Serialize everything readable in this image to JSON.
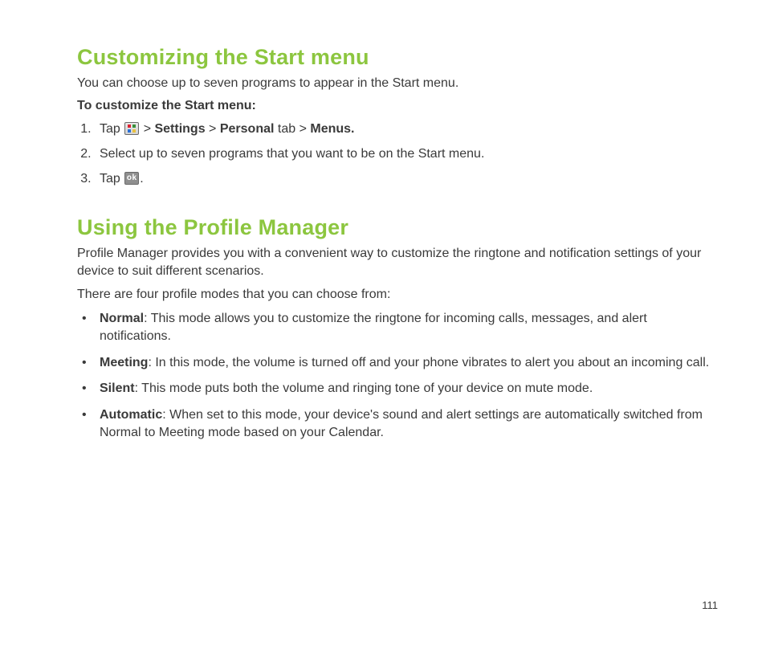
{
  "page_number": "111",
  "section1": {
    "title": "Customizing the Start menu",
    "intro": "You can choose up to seven programs to appear in the Start menu.",
    "subhead": "To customize the Start menu:",
    "step1": {
      "tap": "Tap ",
      "gt1": " > ",
      "settings": "Settings",
      "gt2": " > ",
      "personal": "Personal",
      "tab": " tab > ",
      "menus": "Menus."
    },
    "step2": "Select up to seven programs that you want to be on the Start menu.",
    "step3": {
      "tap": "Tap ",
      "period": "."
    }
  },
  "section2": {
    "title": "Using the Profile Manager",
    "intro1": "Profile Manager provides you with a convenient way to customize the ringtone and notification settings of your device to suit different scenarios.",
    "intro2": "There are four profile modes that you can choose from:",
    "modes": {
      "normal": {
        "name": "Normal",
        "desc": ": This mode allows you to customize the ringtone for incoming calls, messages, and alert notifications."
      },
      "meeting": {
        "name": "Meeting",
        "desc": ": In this mode, the volume is turned off and your phone vibrates to alert you about an incoming call."
      },
      "silent": {
        "name": "Silent",
        "desc": ": This mode puts both the volume and ringing tone of your device on mute mode."
      },
      "automatic": {
        "name": "Automatic",
        "desc": ": When set to this mode, your device's sound and alert settings are automatically switched from Normal to Meeting mode based on your Calendar."
      }
    }
  }
}
